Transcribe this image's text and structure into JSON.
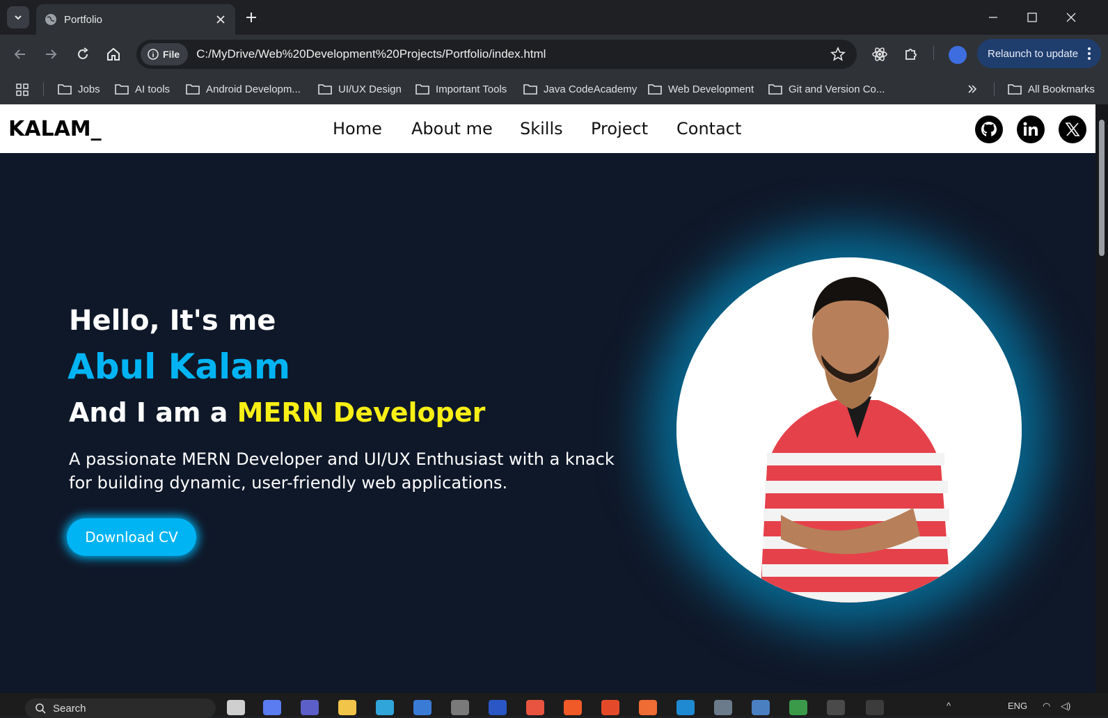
{
  "browser": {
    "tab_title": "Portfolio",
    "address_chip": "File",
    "url": "C:/MyDrive/Web%20Development%20Projects/Portfolio/index.html",
    "relaunch_label": "Relaunch to update",
    "bookmarks": [
      {
        "label": "Jobs"
      },
      {
        "label": "AI tools"
      },
      {
        "label": "Android Developm..."
      },
      {
        "label": "UI/UX Design"
      },
      {
        "label": "Important Tools"
      },
      {
        "label": "Java CodeAcademy"
      },
      {
        "label": "Web Development"
      },
      {
        "label": "Git and Version Co..."
      }
    ],
    "all_bookmarks": "All Bookmarks"
  },
  "site": {
    "logo": "KALAM_",
    "nav": [
      {
        "label": "Home"
      },
      {
        "label": "About me"
      },
      {
        "label": "Skills"
      },
      {
        "label": "Project"
      },
      {
        "label": "Contact"
      }
    ],
    "social_icons": [
      "github-icon",
      "linkedin-icon",
      "x-icon"
    ],
    "hero": {
      "greeting": "Hello, It's me",
      "name": "Abul Kalam",
      "role_prefix": "And I am a",
      "role_highlight": "MERN Developer",
      "description": "A passionate MERN Developer and UI/UX Enthusiast with a knack for building dynamic, user-friendly web applications.",
      "cta": "Download CV"
    },
    "colors": {
      "accent_blue": "#00b4f3",
      "accent_yellow": "#f7ef15",
      "background": "#0f1829"
    }
  },
  "taskbar": {
    "search_placeholder": "Search",
    "language": "ENG"
  }
}
